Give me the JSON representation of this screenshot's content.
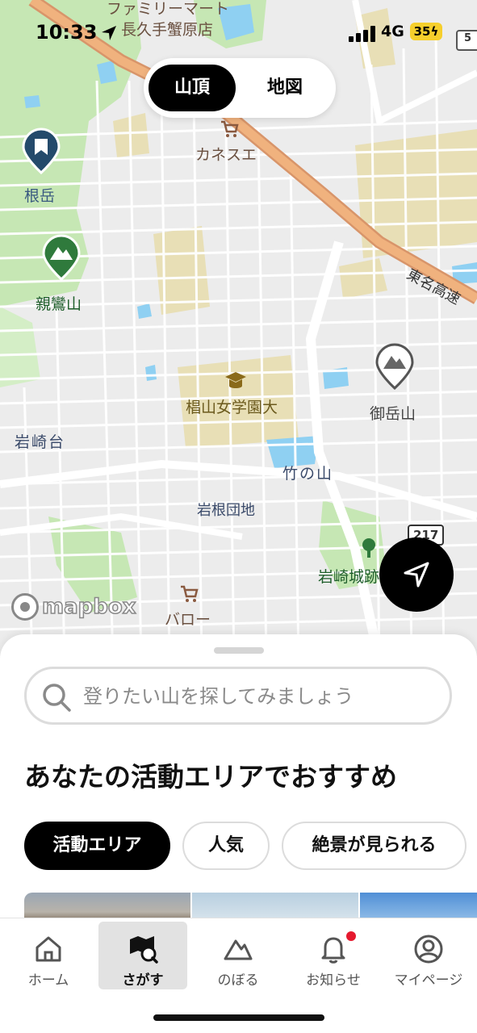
{
  "status_bar": {
    "time": "10:33",
    "network": "4G",
    "battery": "35"
  },
  "map": {
    "labels": {
      "familymart": "ファミリーマート",
      "nagakute": "長久手蟹原店",
      "kanesue": "カネスエ",
      "negatake": "根岳",
      "shinrozan": "親鸞山",
      "tomei": "東名高速",
      "university": "椙山女学園大",
      "ontakesan": "御岳山",
      "iwasakidai": "岩崎台",
      "takenoyama": "竹の山",
      "iwanedanchi": "岩根団地",
      "route217": "217",
      "iwasakijo": "岩崎城跡",
      "baro": "バロー",
      "route5": "5"
    },
    "mapbox_text": "mapbox"
  },
  "toggle": {
    "options": [
      "山頂",
      "地図"
    ],
    "selected": "山頂"
  },
  "search": {
    "placeholder": "登りたい山を探してみましょう"
  },
  "section_heading": "あなたの活動エリアでおすすめ",
  "chips": [
    {
      "label": "活動エリア",
      "active": true
    },
    {
      "label": "人気",
      "active": false
    },
    {
      "label": "絶景が見られる",
      "active": false
    }
  ],
  "tabbar": {
    "tabs": [
      {
        "label": "ホーム",
        "icon": "home-icon"
      },
      {
        "label": "さがす",
        "icon": "map-search-icon",
        "active": true
      },
      {
        "label": "のぼる",
        "icon": "mountain-icon"
      },
      {
        "label": "お知らせ",
        "icon": "bell-icon",
        "badge": true
      },
      {
        "label": "マイページ",
        "icon": "person-icon"
      }
    ]
  },
  "colors": {
    "accent": "#000000",
    "park_green": "#c6e7b4",
    "water": "#8fd0f2",
    "highway": "#f0b27e",
    "campus": "#e8dfb6",
    "battery": "#f6cf2c",
    "badge": "#e5192e",
    "mountain_pin_green": "#2f7a3c",
    "bookmark_pin": "#244a6b"
  }
}
